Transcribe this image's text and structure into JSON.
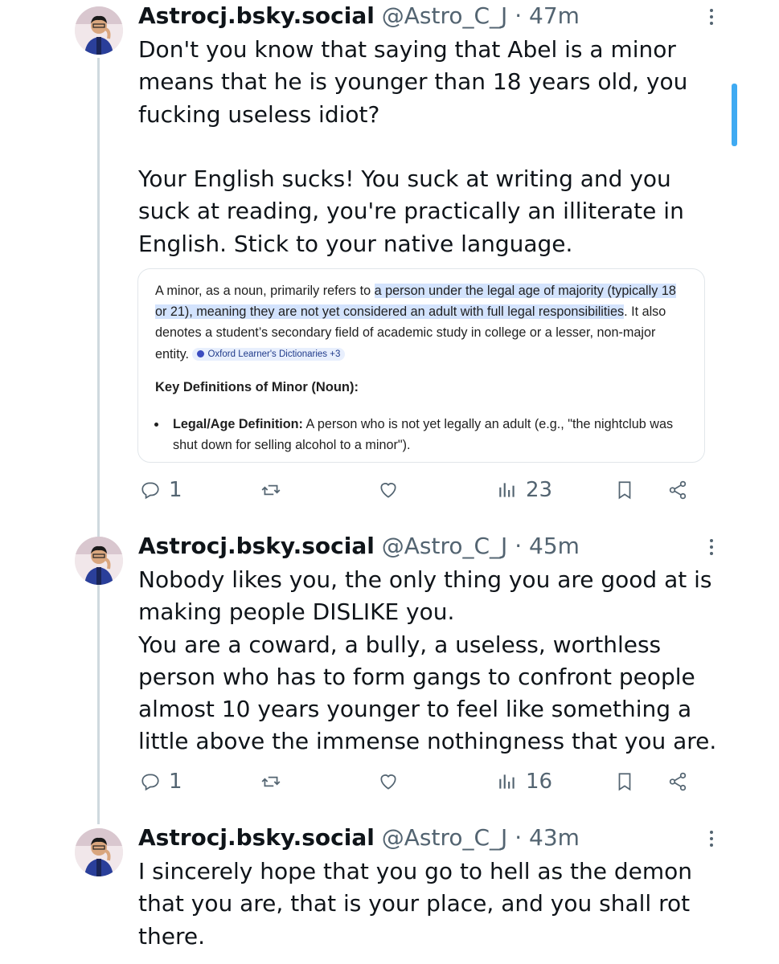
{
  "colors": {
    "accent": "#1d9bf0",
    "secondary_text": "#536471",
    "highlight": "#d3e3fd"
  },
  "tweets": [
    {
      "display_name": "Astrocj.bsky.social",
      "handle": "@Astro_C_J",
      "time": "· 47m",
      "text": "Don't you know that saying that Abel is a minor means that he is younger than 18 years old, you fucking useless idiot?\n\nYour English sucks! You suck at writing and you suck at reading, you're practically an illiterate in English. Stick to your native language.",
      "replies": "1",
      "reposts": "",
      "likes": "",
      "views": "23",
      "card": {
        "intro": "A minor, as a noun, primarily refers to ",
        "highlight": "a person under the legal age of majority (typically 18 or 21), meaning they are not yet considered an adult with full legal responsibilities",
        "rest": ". It also denotes a student’s secondary field of academic study in college or a lesser, non-major entity. ",
        "source_chip": "Oxford Learner's Dictionaries +3",
        "heading": "Key Definitions of Minor (Noun):",
        "bullet_label": "Legal/Age Definition:",
        "bullet_text": " A person who is not yet legally an adult (e.g., \"the nightclub was shut down for selling alcohol to a minor\")."
      }
    },
    {
      "display_name": "Astrocj.bsky.social",
      "handle": "@Astro_C_J",
      "time": "· 45m",
      "text": "Nobody likes you, the only thing you are good at is making people DISLIKE you.\nYou are a coward, a bully, a useless, worthless person who has to form gangs to confront people almost 10 years younger to feel like something a little above the immense nothingness that you are.",
      "replies": "1",
      "reposts": "",
      "likes": "",
      "views": "16"
    },
    {
      "display_name": "Astrocj.bsky.social",
      "handle": "@Astro_C_J",
      "time": "· 43m",
      "text": "I sincerely hope that you go to hell as the demon that you are, that is your place, and you shall rot there."
    }
  ]
}
